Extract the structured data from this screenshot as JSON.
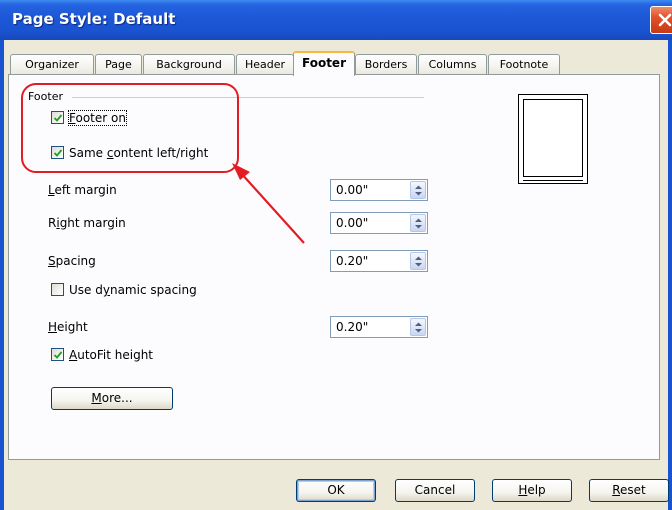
{
  "window": {
    "title": "Page Style: Default"
  },
  "tabs": [
    {
      "label": "Organizer",
      "active": false
    },
    {
      "label": "Page",
      "active": false
    },
    {
      "label": "Background",
      "active": false
    },
    {
      "label": "Header",
      "active": false
    },
    {
      "label": "Footer",
      "active": true
    },
    {
      "label": "Borders",
      "active": false
    },
    {
      "label": "Columns",
      "active": false
    },
    {
      "label": "Footnote",
      "active": false
    }
  ],
  "footer": {
    "group_label": "Footer",
    "footer_on": {
      "label_mnemonic": "F",
      "label_rest": "ooter on",
      "checked": true
    },
    "same_content": {
      "label_pre": "Same ",
      "label_mnemonic": "c",
      "label_rest": "ontent left/right",
      "checked": true
    },
    "left_margin": {
      "label_mnemonic": "L",
      "label_rest": "eft margin",
      "value": "0.00\""
    },
    "right_margin": {
      "label_pre": "R",
      "label_mnemonic": "i",
      "label_rest": "ght margin",
      "value": "0.00\""
    },
    "spacing": {
      "label_mnemonic": "S",
      "label_rest": "pacing",
      "value": "0.20\""
    },
    "dynamic_spacing": {
      "label_pre": "Use d",
      "label_mnemonic": "y",
      "label_rest": "namic spacing",
      "checked": false
    },
    "height": {
      "label_mnemonic": "H",
      "label_rest": "eight",
      "value": "0.20\""
    },
    "autofit": {
      "label_mnemonic": "A",
      "label_rest": "utoFit height",
      "checked": true
    },
    "more_button": {
      "label_mnemonic": "M",
      "label_rest": "ore..."
    }
  },
  "buttons": {
    "ok": "OK",
    "cancel": "Cancel",
    "help": {
      "label_mnemonic": "H",
      "label_rest": "elp"
    },
    "reset": {
      "label_mnemonic": "R",
      "label_rest": "eset"
    }
  },
  "colors": {
    "annotation": "#e31b23",
    "titlebar": "#1c57d6",
    "active_tab_accent": "#f5b93b"
  },
  "icons": {
    "close": "close-icon",
    "checkmark": "checkmark-icon",
    "spin": "spin-arrows-icon"
  }
}
